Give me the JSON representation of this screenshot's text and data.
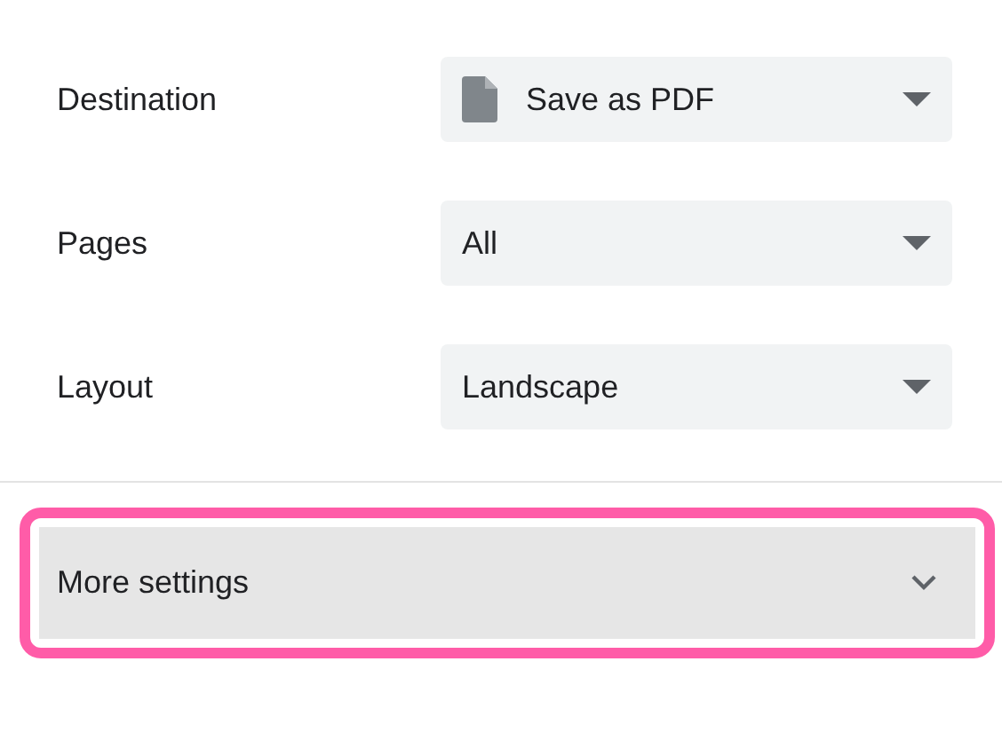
{
  "settings": [
    {
      "label": "Destination",
      "value": "Save as PDF",
      "kind": "file"
    },
    {
      "label": "Pages",
      "value": "All",
      "kind": "plain"
    },
    {
      "label": "Layout",
      "value": "Landscape",
      "kind": "plain"
    }
  ],
  "more_settings": {
    "label": "More settings",
    "expanded": false,
    "highlighted": true
  }
}
